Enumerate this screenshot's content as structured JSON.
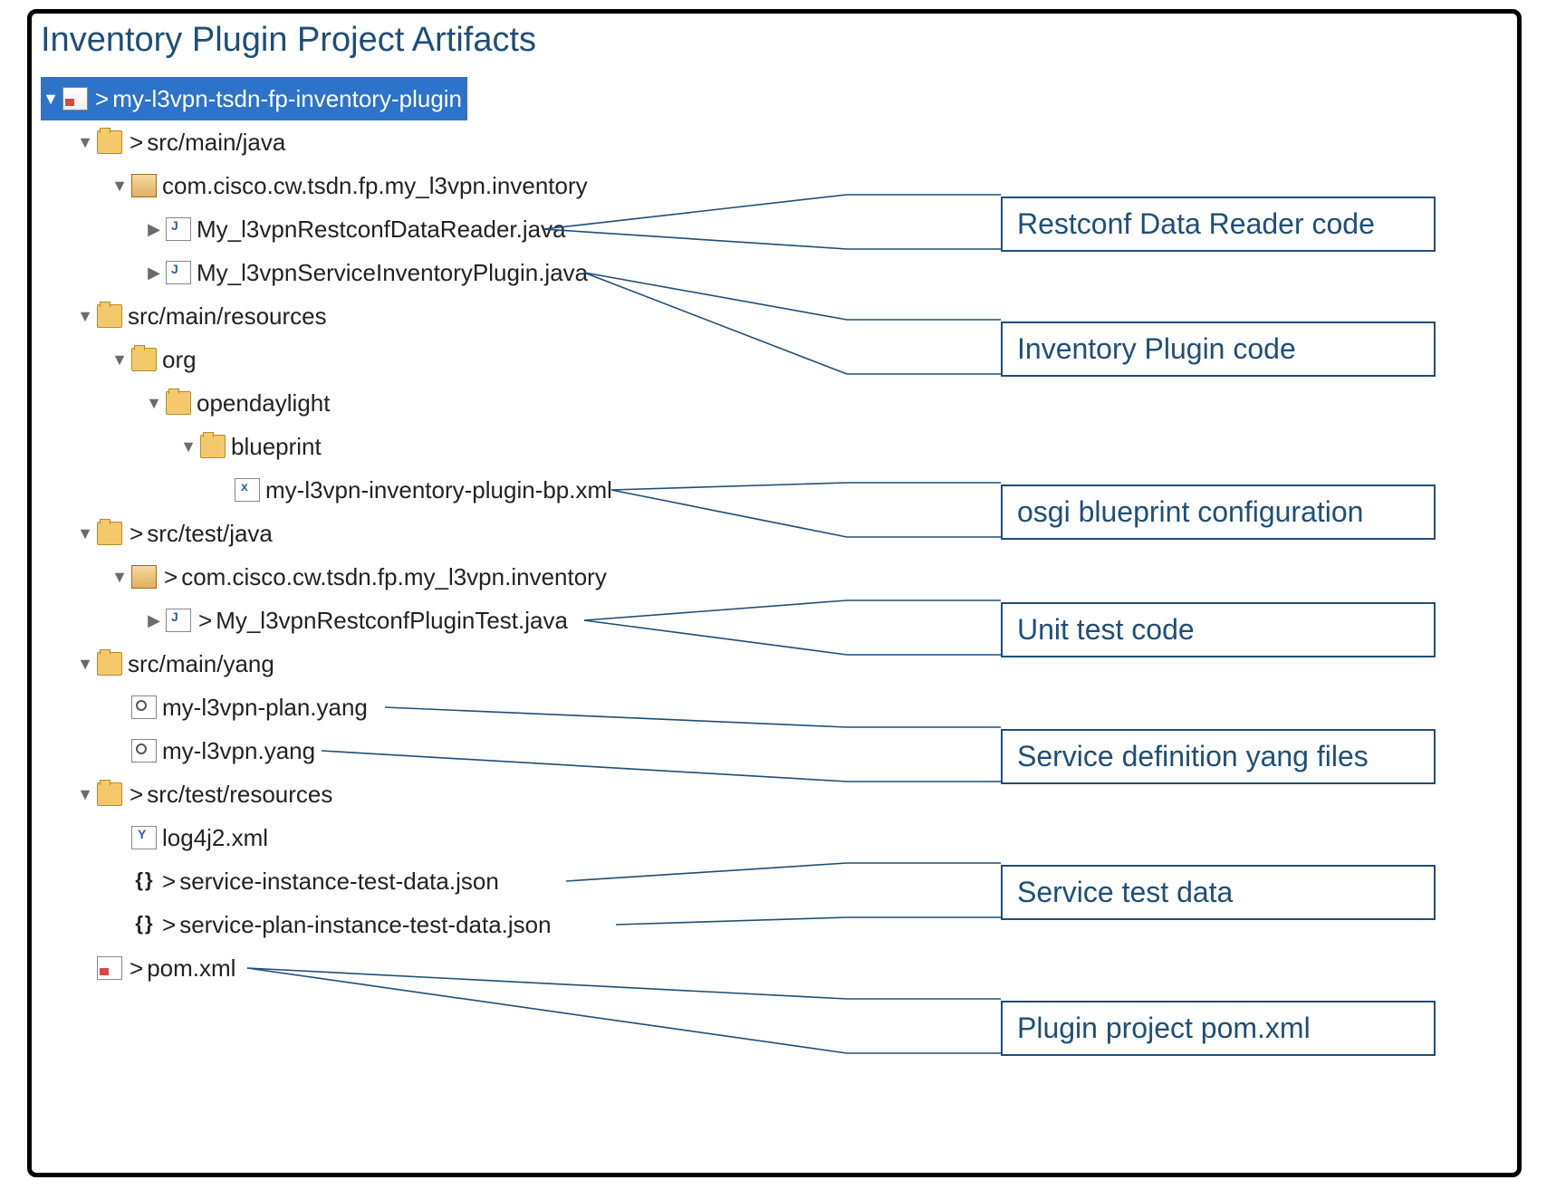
{
  "title": "Inventory Plugin Project Artifacts",
  "tree": {
    "root": "my-l3vpn-tsdn-fp-inventory-plugin",
    "src_main_java": "src/main/java",
    "pkg_inventory": "com.cisco.cw.tsdn.fp.my_l3vpn.inventory",
    "file_datareader": "My_l3vpnRestconfDataReader.java",
    "file_inventoryplugin": "My_l3vpnServiceInventoryPlugin.java",
    "src_main_resources": "src/main/resources",
    "folder_org": "org",
    "folder_opendaylight": "opendaylight",
    "folder_blueprint": "blueprint",
    "file_bpxml": "my-l3vpn-inventory-plugin-bp.xml",
    "src_test_java": "src/test/java",
    "pkg_inventory_test": "com.cisco.cw.tsdn.fp.my_l3vpn.inventory",
    "file_plugintest": "My_l3vpnRestconfPluginTest.java",
    "src_main_yang": "src/main/yang",
    "file_planyang": "my-l3vpn-plan.yang",
    "file_yang": "my-l3vpn.yang",
    "src_test_resources": "src/test/resources",
    "file_log4j2": "log4j2.xml",
    "file_svcinst_json": "service-instance-test-data.json",
    "file_svcplan_json": "service-plan-instance-test-data.json",
    "file_pom": "pom.xml"
  },
  "callouts": {
    "c1": "Restconf Data Reader code",
    "c2": "Inventory Plugin code",
    "c3": "osgi blueprint configuration",
    "c4": "Unit test code",
    "c5": "Service definition yang files",
    "c6": "Service test data",
    "c7": "Plugin project pom.xml"
  }
}
